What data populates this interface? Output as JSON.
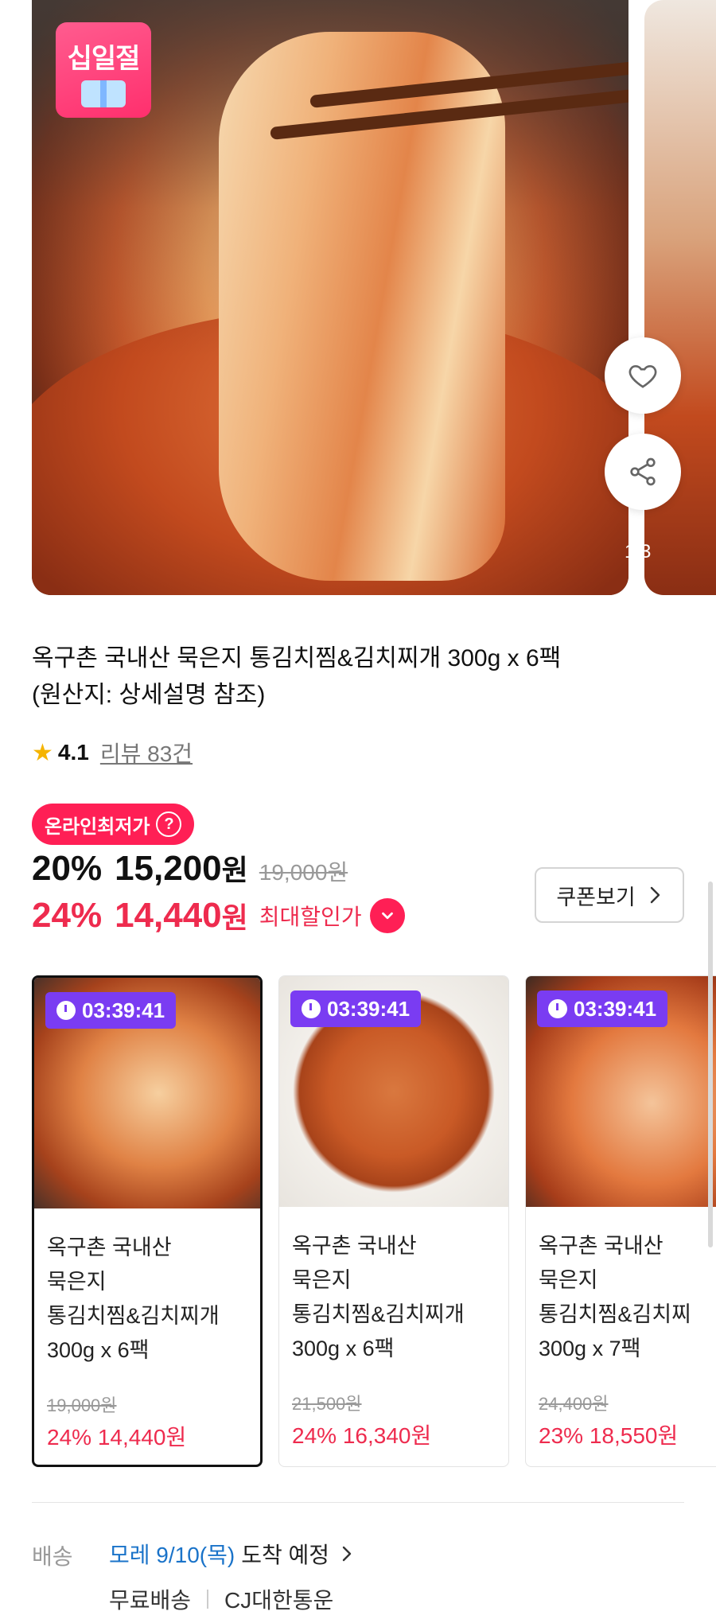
{
  "gallery": {
    "event_badge": "십일절",
    "page_indicator": "1/3"
  },
  "product": {
    "title_line1": "옥구촌 국내산 묵은지 통김치찜&김치찌개 300g x 6팩",
    "title_line2": "(원산지: 상세설명 참조)",
    "rating": "4.1",
    "reviews": "리뷰 83건"
  },
  "price": {
    "lowest_badge": "온라인최저가",
    "discount_pct": "20%",
    "sale_price": "15,200",
    "currency": "원",
    "original_price": "19,000원",
    "max_pct": "24%",
    "max_price": "14,440",
    "max_label": "최대할인가",
    "coupon_label": "쿠폰보기"
  },
  "options": [
    {
      "timer": "03:39:41",
      "name": "옥구촌 국내산\n묵은지\n통김치찜&김치찌개\n300g x 6팩",
      "orig": "19,000원",
      "sale": "24% 14,440원",
      "selected": true
    },
    {
      "timer": "03:39:41",
      "name": "옥구촌 국내산\n묵은지\n통김치찜&김치찌개\n300g x 6팩",
      "orig": "21,500원",
      "sale": "24% 16,340원",
      "selected": false
    },
    {
      "timer": "03:39:41",
      "name": "옥구촌 국내산\n묵은지\n통김치찜&김치찌\n300g x 7팩",
      "orig": "24,400원",
      "sale": "23% 18,550원",
      "selected": false
    }
  ],
  "shipping": {
    "label": "배송",
    "date": "모레 9/10(목)",
    "arrival": "도착 예정",
    "free": "무료배송",
    "carrier": "CJ대한통운"
  },
  "colors": {
    "accent_red": "#ee2b4e",
    "badge_pink": "#ff1f55",
    "timer_purple": "#7a3cf2",
    "link_blue": "#1a73c9"
  }
}
